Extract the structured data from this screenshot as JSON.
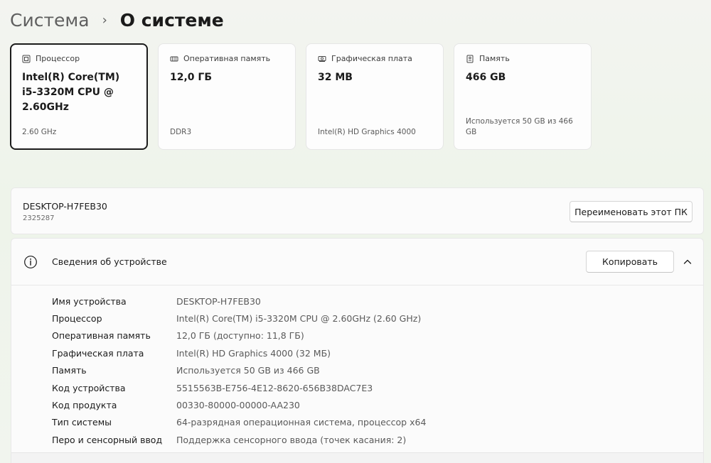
{
  "breadcrumb": {
    "parent": "Система",
    "separator": "›",
    "current": "О системе"
  },
  "cards": [
    {
      "label": "Процессор",
      "value": "Intel(R) Core(TM) i5-3320M CPU @ 2.60GHz",
      "sub": "2.60 GHz",
      "icon": "processor-icon"
    },
    {
      "label": "Оперативная память",
      "value": "12,0 ГБ",
      "sub": "DDR3",
      "icon": "memory-icon"
    },
    {
      "label": "Графическая плата",
      "value": "32 MB",
      "sub": "Intel(R) HD Graphics 4000",
      "icon": "graphics-card-icon"
    },
    {
      "label": "Память",
      "value": "466 GB",
      "sub": "Используется 50 GB из 466 GB",
      "icon": "storage-icon"
    }
  ],
  "pc": {
    "name": "DESKTOP-H7FEB30",
    "id": "2325287",
    "rename_label": "Переименовать этот ПК"
  },
  "device_info": {
    "title": "Сведения об устройстве",
    "copy_label": "Копировать",
    "rows": [
      {
        "label": "Имя устройства",
        "value": "DESKTOP-H7FEB30"
      },
      {
        "label": "Процессор",
        "value": "Intel(R) Core(TM) i5-3320M CPU @ 2.60GHz (2.60 GHz)"
      },
      {
        "label": "Оперативная память",
        "value": "12,0 ГБ (доступно: 11,8 ГБ)"
      },
      {
        "label": "Графическая плата",
        "value": "Intel(R) HD Graphics 4000 (32 МБ)"
      },
      {
        "label": "Память",
        "value": "Используется 50 GB из 466 GB"
      },
      {
        "label": "Код устройства",
        "value": "5515563B-E756-4E12-8620-656B38DAC7E3"
      },
      {
        "label": "Код продукта",
        "value": "00330-80000-00000-AA230"
      },
      {
        "label": "Тип системы",
        "value": "64-разрядная операционная система, процессор x64"
      },
      {
        "label": "Перо и сенсорный ввод",
        "value": "Поддержка сенсорного ввода (точек касания: 2)"
      }
    ]
  }
}
